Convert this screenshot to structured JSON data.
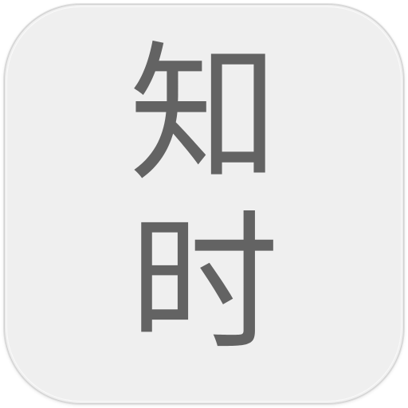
{
  "app_icon": {
    "characters": [
      "知",
      "时"
    ],
    "background_color": "#efefef",
    "text_color": "#636363"
  }
}
